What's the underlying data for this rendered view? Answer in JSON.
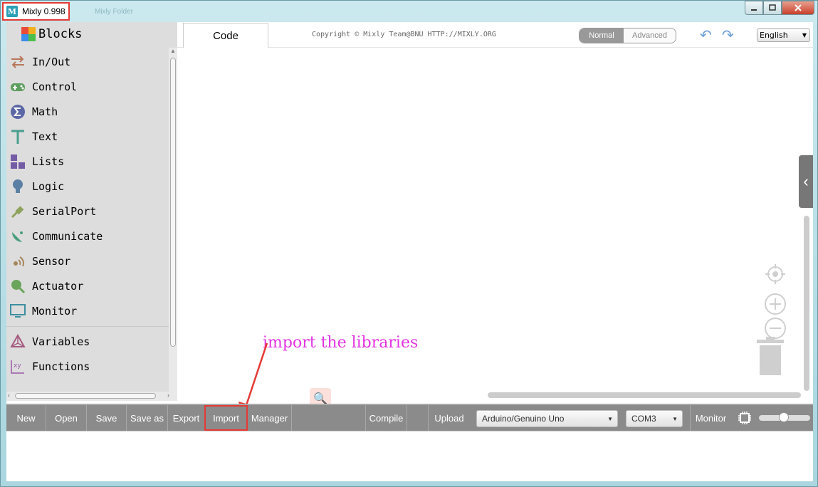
{
  "window": {
    "title": "Mixly 0.998",
    "app_icon_glyph": "M",
    "ghost_title": "Mixly Folder",
    "icons": [
      "minimize-icon",
      "maximize-icon",
      "close-icon"
    ]
  },
  "sidebar": {
    "header": "Blocks",
    "categories": [
      {
        "label": "In/Out",
        "icon": "swap-arrows-icon",
        "color": "#b8775a"
      },
      {
        "label": "Control",
        "icon": "gamepad-icon",
        "color": "#5f9e5f"
      },
      {
        "label": "Math",
        "icon": "sigma-icon",
        "color": "#5b67a5"
      },
      {
        "label": "Text",
        "icon": "text-t-icon",
        "color": "#4a9e8e"
      },
      {
        "label": "Lists",
        "icon": "blocks-grid-icon",
        "color": "#745ba5"
      },
      {
        "label": "Logic",
        "icon": "lightbulb-icon",
        "color": "#5b80a5"
      },
      {
        "label": "SerialPort",
        "icon": "usb-plug-icon",
        "color": "#8ea35c"
      },
      {
        "label": "Communicate",
        "icon": "satellite-dish-icon",
        "color": "#4a9e7e"
      },
      {
        "label": "Sensor",
        "icon": "sensor-waves-icon",
        "color": "#a5855b"
      },
      {
        "label": "Actuator",
        "icon": "motor-icon",
        "color": "#6aa55b"
      },
      {
        "label": "Monitor",
        "icon": "monitor-icon",
        "color": "#3f8fa0"
      },
      {
        "label": "Variables",
        "icon": "variables-icon",
        "color": "#a55b80"
      },
      {
        "label": "Functions",
        "icon": "function-xy-icon",
        "color": "#995ba5"
      }
    ]
  },
  "topbar": {
    "code_tab": "Code",
    "copyright": "Copyright © Mixly Team@BNU HTTP://MIXLY.ORG",
    "mode_normal": "Normal",
    "mode_advanced": "Advanced",
    "language": "English",
    "undo_glyph": "↶",
    "redo_glyph": "↷"
  },
  "canvas": {
    "annotation": "import the libraries",
    "side_tab_glyph": "‹",
    "search_glyph": "🔍"
  },
  "toolbar": {
    "buttons": [
      "New",
      "Open",
      "Save",
      "Save as",
      "Export",
      "Import",
      "Manager",
      "Compile",
      "Upload"
    ],
    "board": "Arduino/Genuino Uno",
    "port": "COM3",
    "monitor": "Monitor"
  },
  "colors": {
    "highlight": "#e53935",
    "annotation": "#e334e3",
    "toolbar_bg": "#8b8b8b",
    "sidebar_bg": "#dddddd"
  }
}
